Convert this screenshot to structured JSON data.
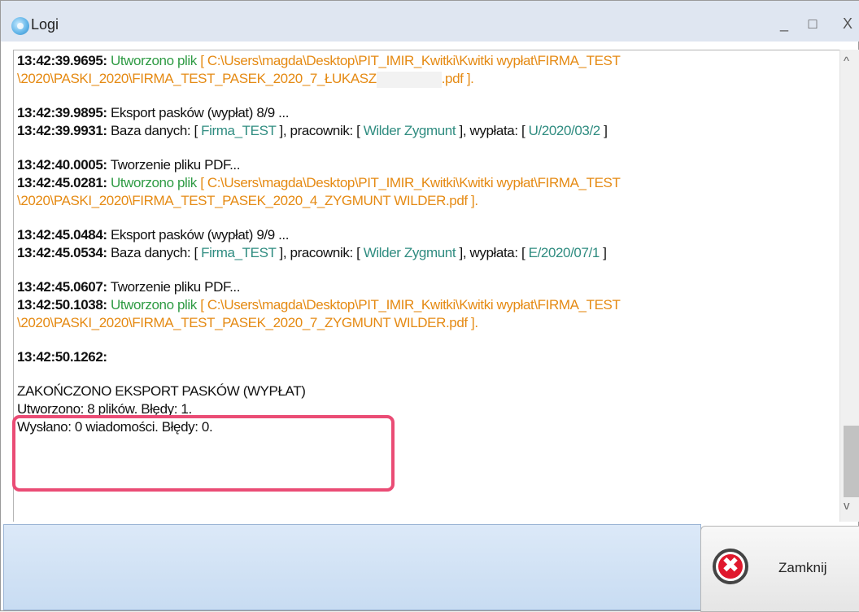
{
  "window": {
    "title": "Logi",
    "min_glyph": "_",
    "max_glyph": "□",
    "close_glyph": "X"
  },
  "log": {
    "entries": [
      {
        "ts": "13:42:39.9695:",
        "l1": [
          "Utworzono plik",
          "[ C:\\Users\\magda\\Desktop\\PIT_IMIR_Kwitki\\Kwitki wypłat\\FIRMA_TEST"
        ],
        "l2a": "\\2020\\PASKI_2020\\FIRMA_TEST_PASEK_2020_7_ŁUKASZ",
        "l2b": ".pdf ]."
      },
      {
        "ts1": "13:42:39.9895:",
        "t1": "Eksport pasków (wypłat) 8/9 ...",
        "ts2": "13:42:39.9931:",
        "db": "Firma_TEST",
        "emp": "Wilder Zygmunt",
        "pay": "U/2020/03/2"
      },
      {
        "ts1": "13:42:40.0005:",
        "t1": "Tworzenie pliku PDF...",
        "ts2": "13:42:45.0281:",
        "created": "Utworzono plik",
        "path1": "[ C:\\Users\\magda\\Desktop\\PIT_IMIR_Kwitki\\Kwitki wypłat\\FIRMA_TEST",
        "path2": "\\2020\\PASKI_2020\\FIRMA_TEST_PASEK_2020_4_ZYGMUNT WILDER.pdf ]."
      },
      {
        "ts1": "13:42:45.0484:",
        "t1": "Eksport pasków (wypłat) 9/9 ...",
        "ts2": "13:42:45.0534:",
        "db": "Firma_TEST",
        "emp": "Wilder Zygmunt",
        "pay": "E/2020/07/1"
      },
      {
        "ts1": "13:42:45.0607:",
        "t1": "Tworzenie pliku PDF...",
        "ts2": "13:42:50.1038:",
        "created": "Utworzono plik",
        "path1": "[ C:\\Users\\magda\\Desktop\\PIT_IMIR_Kwitki\\Kwitki wypłat\\FIRMA_TEST",
        "path2": "\\2020\\PASKI_2020\\FIRMA_TEST_PASEK_2020_7_ZYGMUNT WILDER.pdf ]."
      },
      {
        "ts": "13:42:50.1262:"
      }
    ],
    "labels": {
      "db_prefix": "Baza danych: [ ",
      "emp_prefix": "], pracownik: [ ",
      "pay_prefix": "], wypłata: [ ",
      "suffix": "]"
    },
    "summary": {
      "title": "ZAKOŃCZONO EKSPORT PASKÓW (WYPŁAT)",
      "created": "Utworzono: 8 plików. Błędy: 1.",
      "sent": "Wysłano: 0 wiadomości. Błędy: 0."
    }
  },
  "scroll": {
    "up": "^",
    "down": "v"
  },
  "buttons": {
    "close_label": "Zamknij",
    "close_symbol": "✖"
  },
  "colors": {
    "path": "#e58a13",
    "success": "#2f9b44",
    "value": "#2f8c80",
    "highlight": "#ea4c75"
  }
}
